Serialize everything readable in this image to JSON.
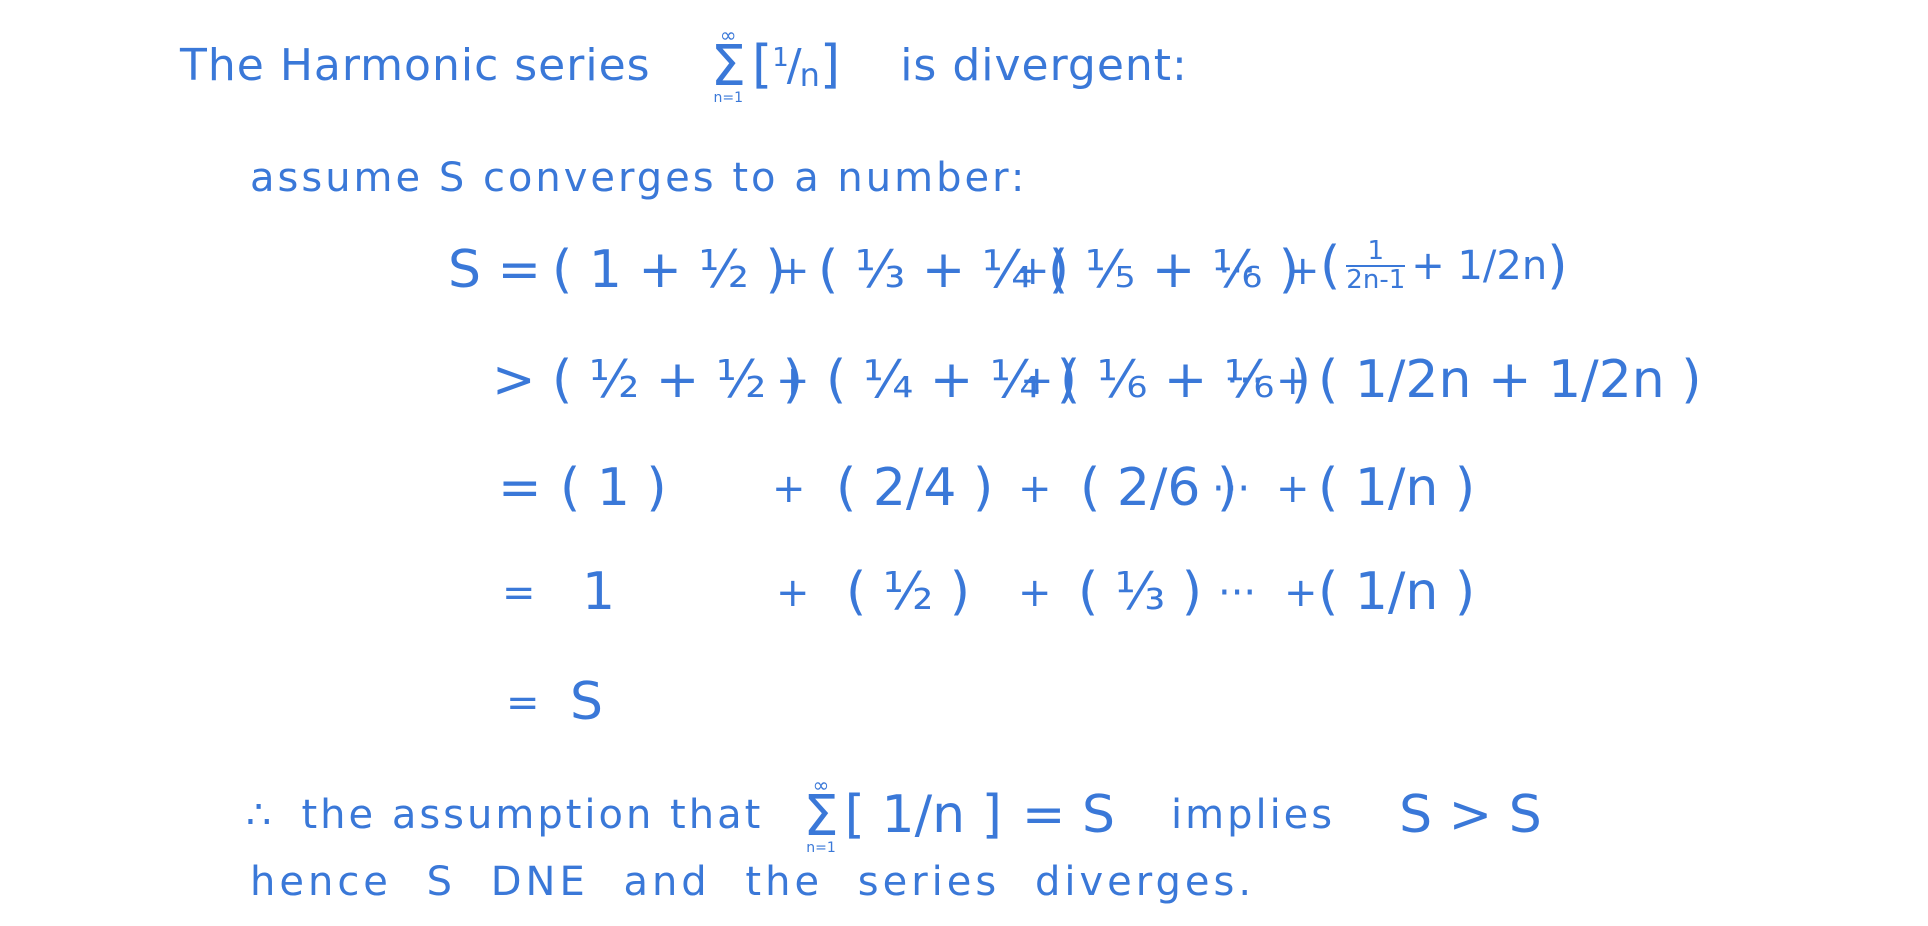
{
  "heading": {
    "pre": "The Harmonic series",
    "sigma_top": "∞",
    "sigma_sym": "Σ",
    "sigma_bottom": "n=1",
    "term_open": "[",
    "term_num": "1",
    "term_den": "n",
    "term_close": "]",
    "post": "is divergent:"
  },
  "assume": "assume S converges to a number:",
  "rows": {
    "r1": {
      "lhs": "S =",
      "g1": "( 1 + ½ )",
      "plus1": "+",
      "g2": "( ⅓ + ¼ )",
      "plus2": "+",
      "g3": "( ⅕ + ⅙ )",
      "dots": "···",
      "plus3": "+",
      "g4_open": "(",
      "g4_num": "1",
      "g4_den": "2n-1",
      "g4_rest": "+ 1/2n",
      "g4_close": ")"
    },
    "r2": {
      "lhs": ">",
      "g1": "( ½ + ½ )",
      "plus1": "+",
      "g2": "( ¼ + ¼ )",
      "plus2": "+",
      "g3": "( ⅙ + ⅙ )",
      "dots": "···",
      "plus3": "+",
      "g4": "( 1/2n + 1/2n )"
    },
    "r3": {
      "lhs": "=",
      "g1": "( 1 )",
      "plus1": "+",
      "g2": "( 2/4 )",
      "plus2": "+",
      "g3": "( 2/6 )",
      "dots": "···",
      "plus3": "+",
      "g4": "( 1/n )"
    },
    "r4": {
      "lhs": "=",
      "g1": "1",
      "plus1": "+",
      "g2": "( ½ )",
      "plus2": "+",
      "g3": "( ⅓ )",
      "dots": "···",
      "plus3": "+",
      "g4": "( 1/n )"
    },
    "r5": {
      "lhs": "=",
      "g1": "S"
    }
  },
  "conclusion": {
    "therefore": "∴",
    "pre": "the assumption that",
    "sigma_top": "∞",
    "sigma_sym": "Σ",
    "sigma_bottom": "n=1",
    "term": "[ 1/n ]",
    "eq": "= S",
    "implies": "implies",
    "result": "S > S",
    "line2": "hence S DNE and the series diverges."
  }
}
